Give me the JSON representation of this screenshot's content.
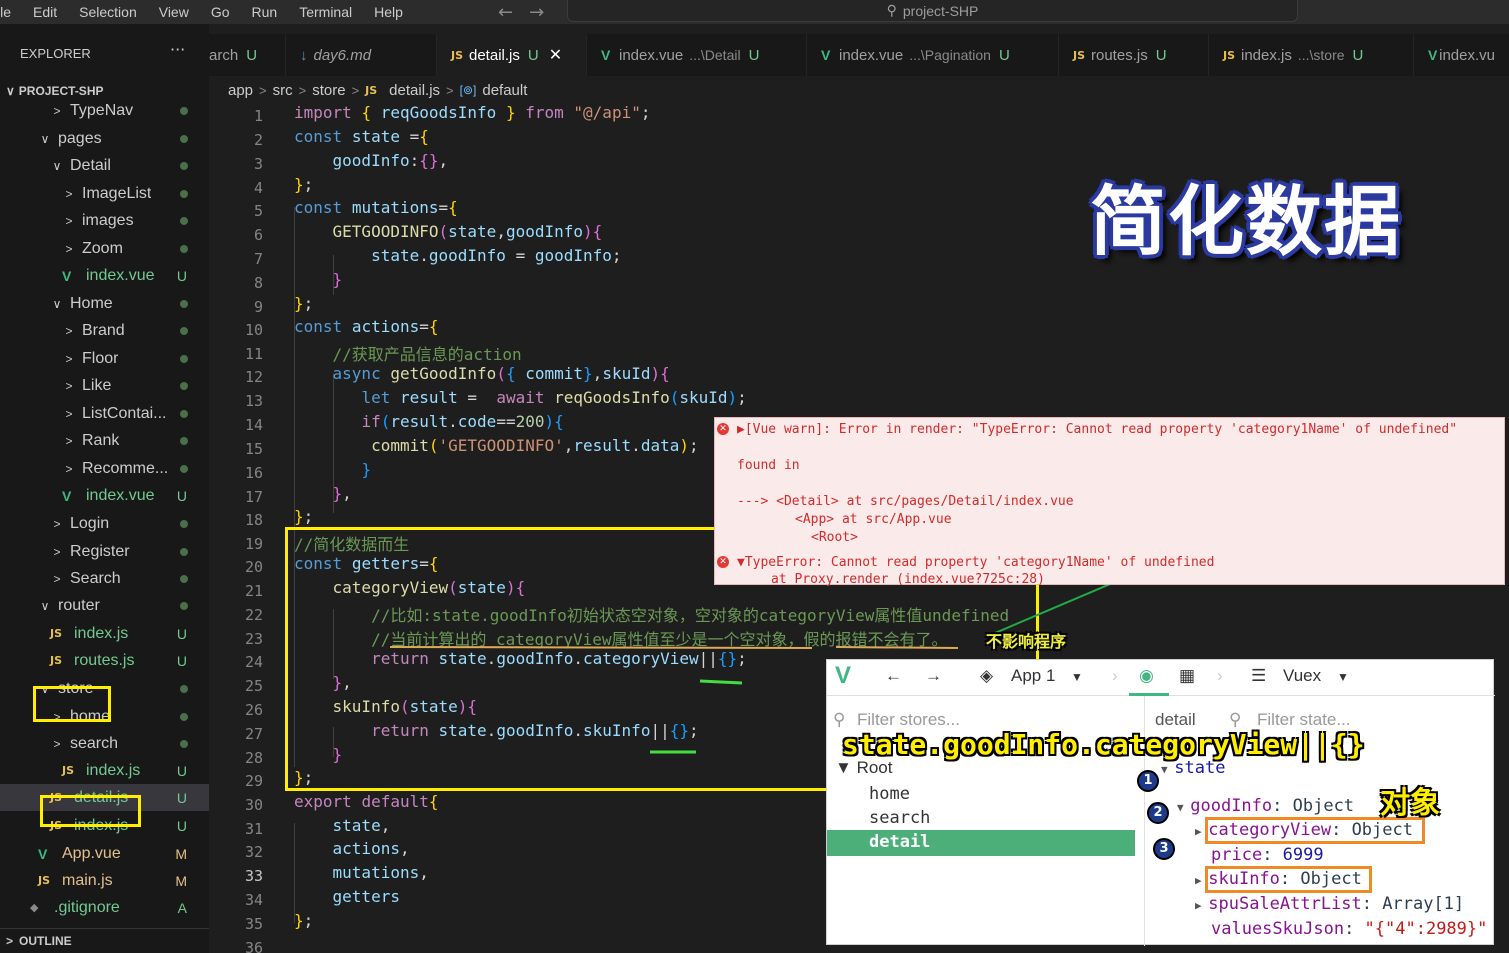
{
  "menu": [
    "ile",
    "Edit",
    "Selection",
    "View",
    "Go",
    "Run",
    "Terminal",
    "Help"
  ],
  "command_center": "project-SHP",
  "sidebar": {
    "header": "EXPLORER",
    "project": "PROJECT-SHP",
    "items": [
      {
        "label": "TypeNav",
        "type": "folder",
        "status": "dot"
      },
      {
        "label": "pages",
        "type": "folder-open",
        "status": "dot"
      },
      {
        "label": "Detail",
        "type": "folder-open",
        "status": "dot"
      },
      {
        "label": "ImageList",
        "type": "folder",
        "status": "dot"
      },
      {
        "label": "images",
        "type": "folder",
        "status": "dot"
      },
      {
        "label": "Zoom",
        "type": "folder",
        "status": "dot"
      },
      {
        "label": "index.vue",
        "type": "vue",
        "status": "U"
      },
      {
        "label": "Home",
        "type": "folder-open",
        "status": "dot"
      },
      {
        "label": "Brand",
        "type": "folder",
        "status": "dot"
      },
      {
        "label": "Floor",
        "type": "folder",
        "status": "dot"
      },
      {
        "label": "Like",
        "type": "folder",
        "status": "dot"
      },
      {
        "label": "ListContai...",
        "type": "folder",
        "status": "dot"
      },
      {
        "label": "Rank",
        "type": "folder",
        "status": "dot"
      },
      {
        "label": "Recomme...",
        "type": "folder",
        "status": "dot"
      },
      {
        "label": "index.vue",
        "type": "vue",
        "status": "U"
      },
      {
        "label": "Login",
        "type": "folder",
        "status": "dot"
      },
      {
        "label": "Register",
        "type": "folder",
        "status": "dot"
      },
      {
        "label": "Search",
        "type": "folder",
        "status": "dot"
      },
      {
        "label": "router",
        "type": "folder-open",
        "status": "dot"
      },
      {
        "label": "index.js",
        "type": "js",
        "status": "U"
      },
      {
        "label": "routes.js",
        "type": "js",
        "status": "U"
      },
      {
        "label": "store",
        "type": "folder-open",
        "status": "dot"
      },
      {
        "label": "home",
        "type": "folder",
        "status": "dot"
      },
      {
        "label": "search",
        "type": "folder",
        "status": "dot"
      },
      {
        "label": "index.js",
        "type": "js",
        "status": "U"
      },
      {
        "label": "detail.js",
        "type": "js",
        "status": "U"
      },
      {
        "label": "index.js",
        "type": "js",
        "status": "U"
      },
      {
        "label": "App.vue",
        "type": "vue",
        "status": "M"
      },
      {
        "label": "main.js",
        "type": "js",
        "status": "M"
      },
      {
        "label": ".gitignore",
        "type": "git",
        "status": "A"
      }
    ],
    "outline": "OUTLINE"
  },
  "tabs": [
    {
      "label": "arch",
      "badge": "U",
      "icon": ""
    },
    {
      "label": "day6.md",
      "badge": "",
      "icon": "md"
    },
    {
      "label": "detail.js",
      "badge": "U",
      "icon": "JS",
      "active": true
    },
    {
      "label": "index.vue",
      "desc": "...\\Detail",
      "badge": "U",
      "icon": "vue"
    },
    {
      "label": "index.vue",
      "desc": "...\\Pagination",
      "badge": "U",
      "icon": "vue"
    },
    {
      "label": "routes.js",
      "badge": "U",
      "icon": "JS"
    },
    {
      "label": "index.js",
      "desc": "...\\store",
      "badge": "U",
      "icon": "JS"
    },
    {
      "label": "index.vu",
      "badge": "",
      "icon": "vue"
    }
  ],
  "breadcrumb": [
    "app",
    "src",
    "store",
    "detail.js",
    "default"
  ],
  "annotations": {
    "title": "简化数据",
    "no_effect": "不影响程序",
    "expr": "state.goodInfo.categoryView||{}",
    "object_label": "对象"
  },
  "error_panel": {
    "line1": "▶[Vue warn]: Error in render: \"TypeError: Cannot read property 'category1Name' of undefined\"",
    "line2": "found in",
    "line3": "---> <Detail> at src/pages/Detail/index.vue",
    "line4": "<App> at src/App.vue",
    "line5": "<Root>",
    "line6": "▼TypeError: Cannot read property 'category1Name' of undefined",
    "line7": "at Proxy.render (index.vue?725c:28)"
  },
  "devtools": {
    "app": "App 1",
    "vuex": "Vuex",
    "filter_stores": "Filter stores...",
    "detail_label": "detail",
    "filter_state": "Filter state...",
    "root": "Root",
    "stores": [
      "home",
      "search",
      "detail"
    ],
    "state": "state",
    "goodInfo_key": "goodInfo",
    "goodInfo_val": "Object",
    "categoryView_key": "categoryView",
    "categoryView_val": "Object",
    "price_key": "price",
    "price_val": "6999",
    "skuInfo_key": "skuInfo",
    "skuInfo_val": "Object",
    "spu_key": "spuSaleAttrList",
    "spu_val": "Array[1]",
    "values_key": "valuesSkuJson",
    "values_val": "\"{\"4\":2989}\""
  },
  "colors": {
    "accent_yellow": "#ffee00",
    "vue_green": "#41b883",
    "error_red": "#d12b2b"
  }
}
